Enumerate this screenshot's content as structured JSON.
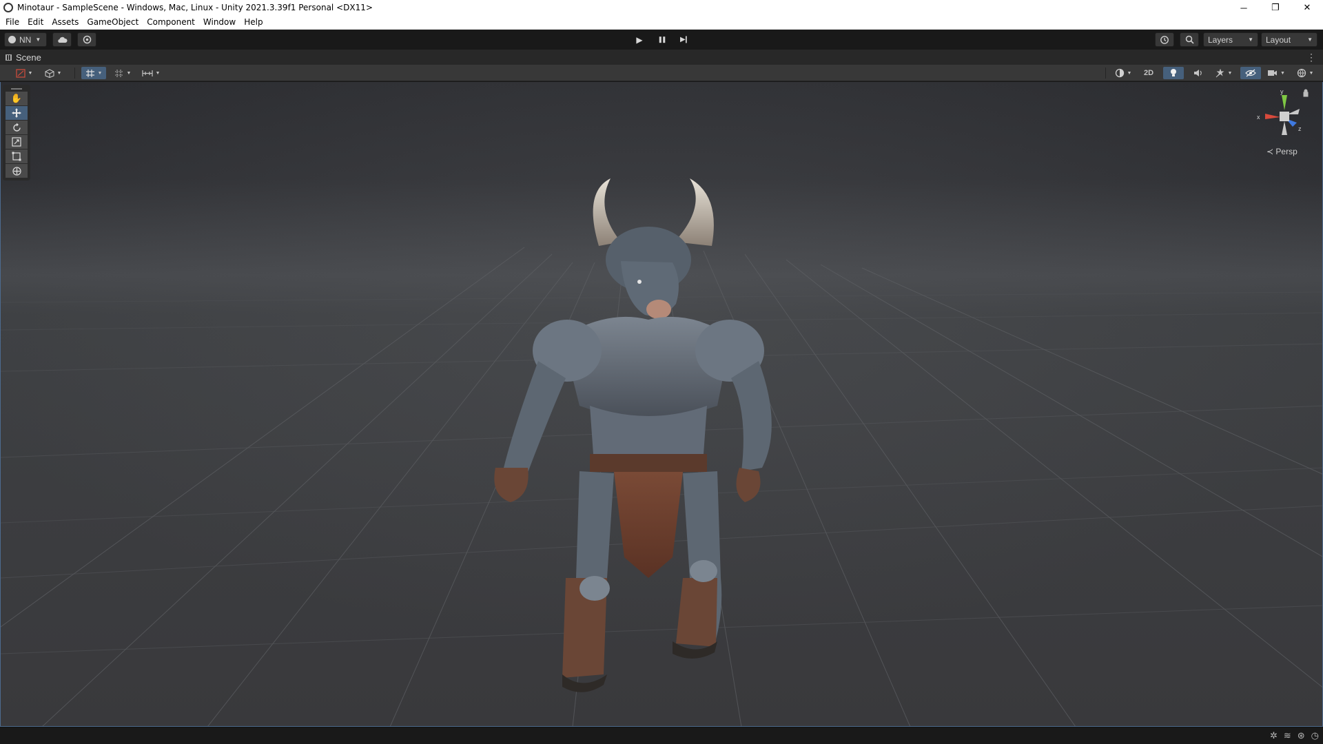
{
  "window": {
    "title": "Minotaur - SampleScene - Windows, Mac, Linux - Unity 2021.3.39f1 Personal <DX11>",
    "controls": {
      "minimize": "─",
      "restore": "❐",
      "close": "✕"
    }
  },
  "menu": [
    "File",
    "Edit",
    "Assets",
    "GameObject",
    "Component",
    "Window",
    "Help"
  ],
  "toolbar": {
    "account": "NN",
    "layers_label": "Layers",
    "layout_label": "Layout",
    "play_icons": {
      "play": "▶",
      "pause": "❚❚",
      "step": "▶❙"
    }
  },
  "scene": {
    "tab_label": "Scene",
    "btn_2d": "2D",
    "persp_label": "Persp",
    "gizmo": {
      "x": "x",
      "y": "y",
      "z": "z"
    }
  },
  "colors": {
    "accent": "#46607c",
    "viewport_sky": "#2c2e33",
    "viewport_ground": "#3b3c40",
    "gizmo_x": "#d84a3c",
    "gizmo_y": "#7fc844",
    "gizmo_z": "#3f79e0"
  }
}
